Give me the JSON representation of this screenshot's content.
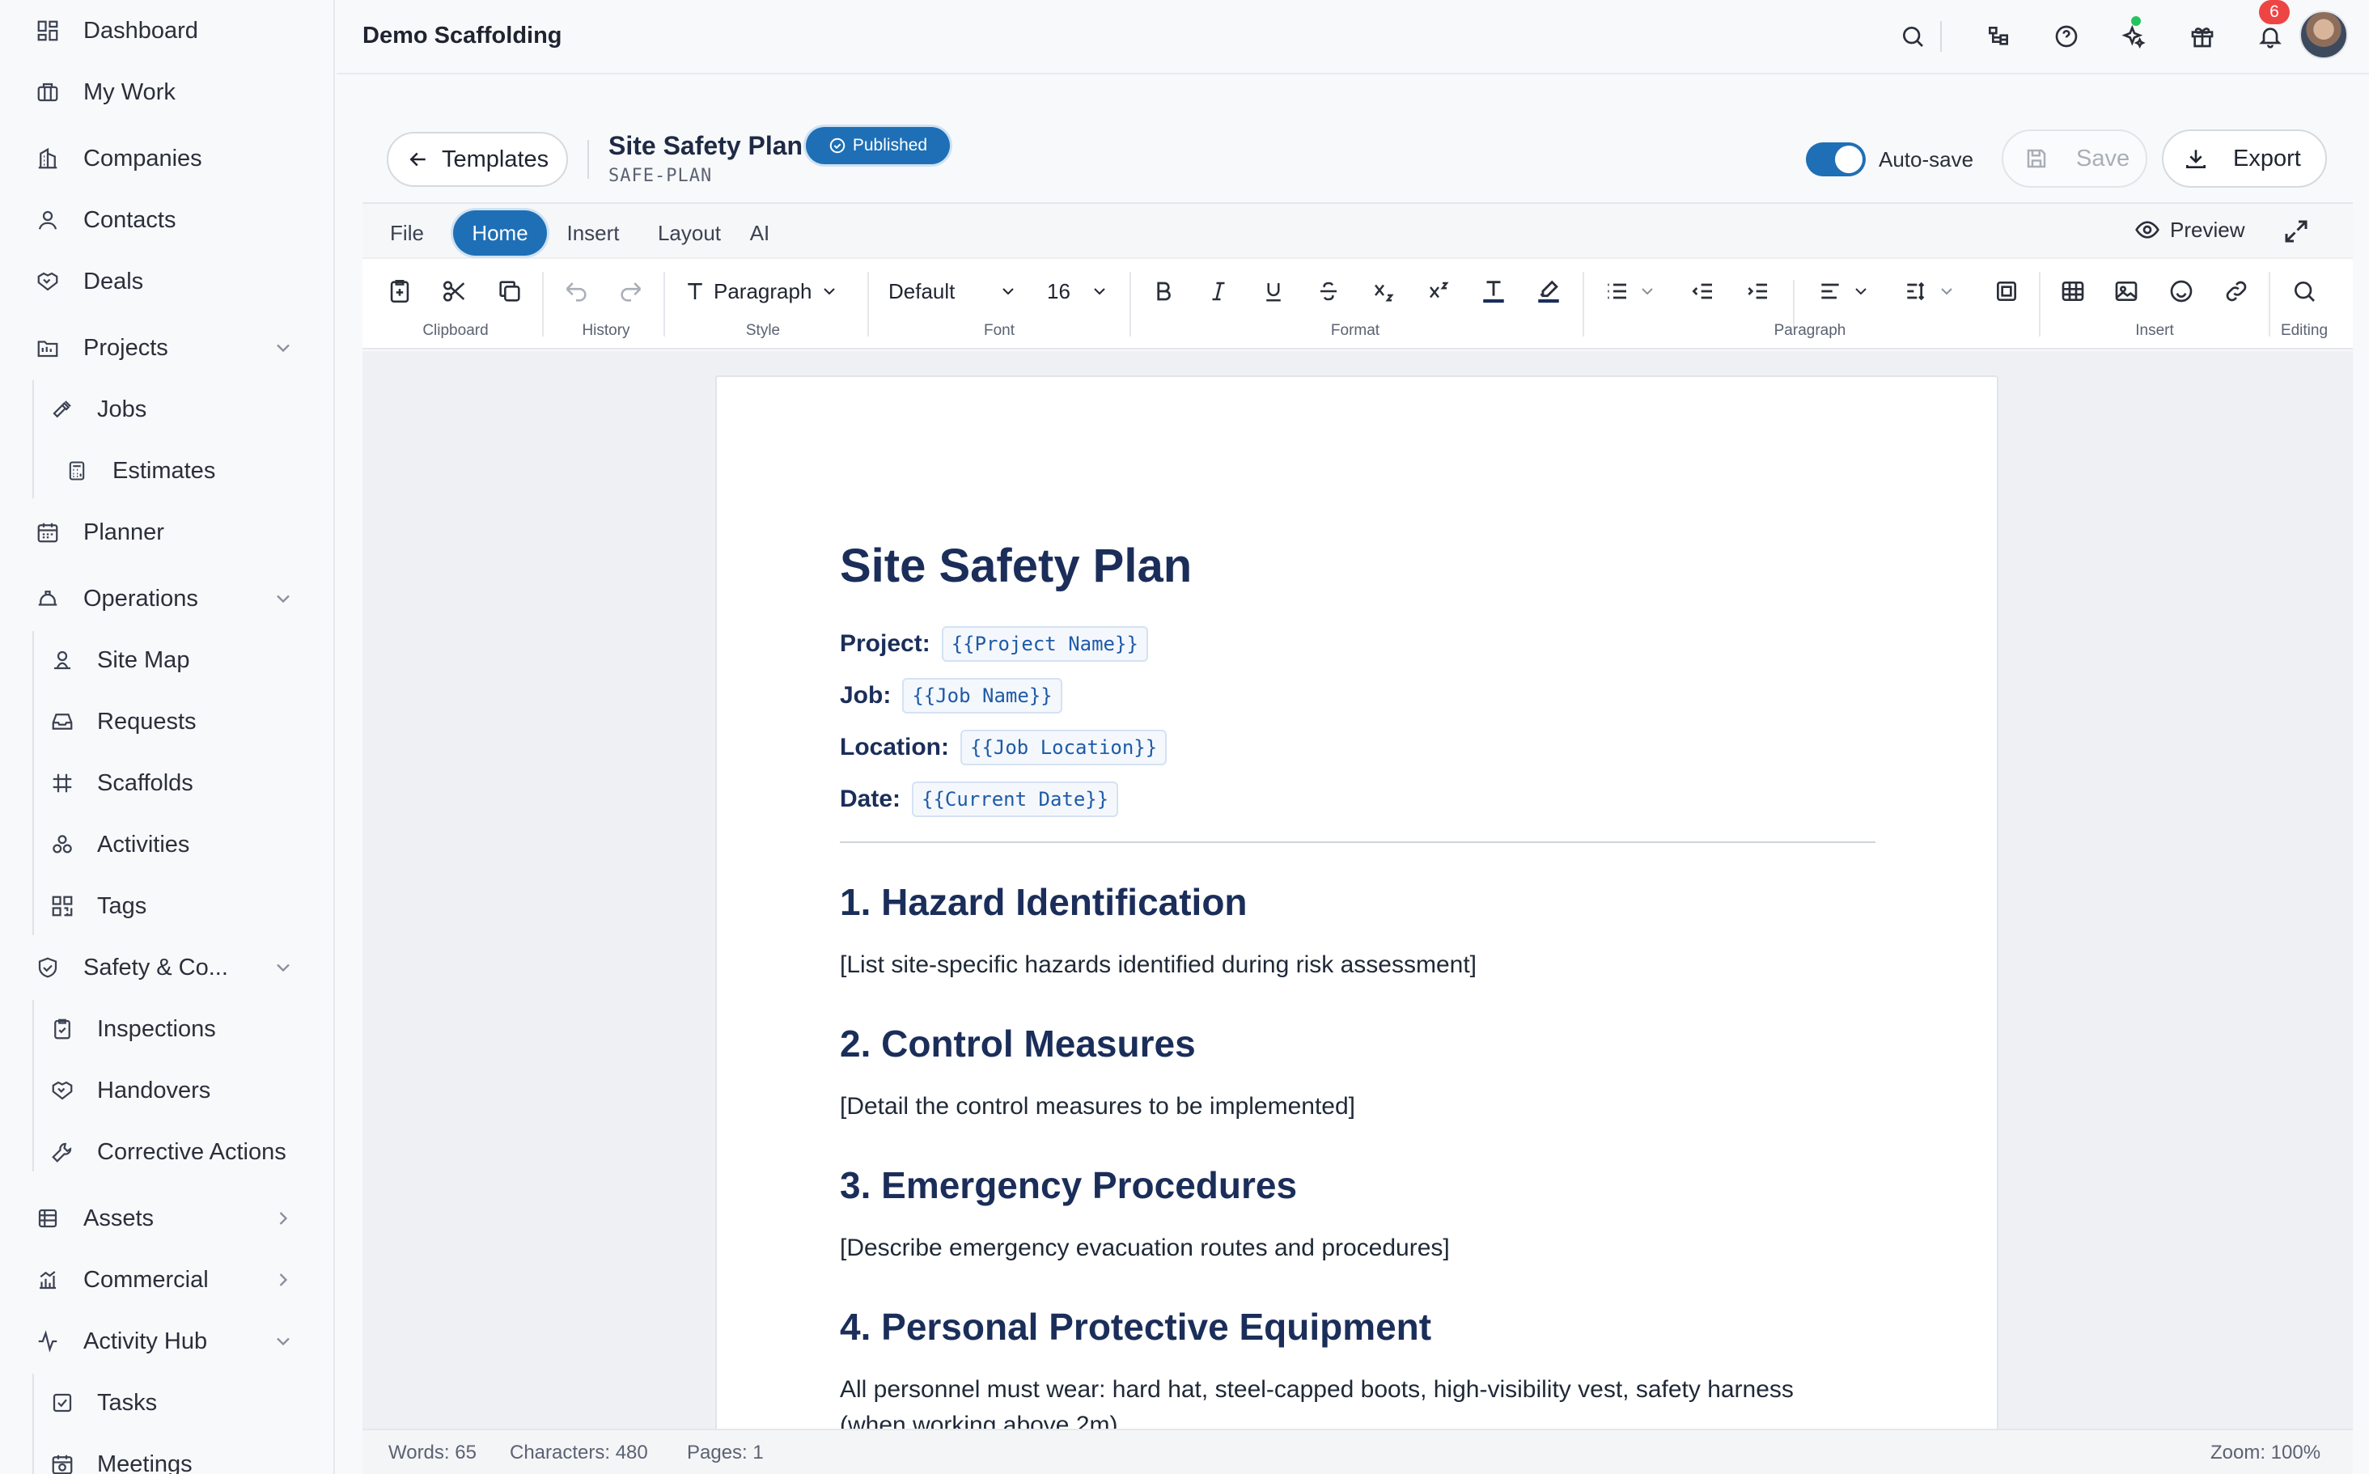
{
  "sidebar": {
    "items": [
      {
        "label": "Dashboard",
        "icon": "dashboard-icon"
      },
      {
        "label": "My Work",
        "icon": "briefcase-icon"
      },
      {
        "label": "Companies",
        "icon": "building-icon"
      },
      {
        "label": "Contacts",
        "icon": "user-icon"
      },
      {
        "label": "Deals",
        "icon": "handshake-icon"
      },
      {
        "label": "Projects",
        "icon": "folder-icon"
      },
      {
        "label": "Jobs",
        "icon": "hammer-icon"
      },
      {
        "label": "Estimates",
        "icon": "calculator-icon"
      },
      {
        "label": "Planner",
        "icon": "calendar-icon"
      },
      {
        "label": "Operations",
        "icon": "hardhat-icon"
      },
      {
        "label": "Site Map",
        "icon": "map-pin-icon"
      },
      {
        "label": "Requests",
        "icon": "inbox-icon"
      },
      {
        "label": "Scaffolds",
        "icon": "grid-hash-icon"
      },
      {
        "label": "Activities",
        "icon": "activities-icon"
      },
      {
        "label": "Tags",
        "icon": "qr-code-icon"
      },
      {
        "label": "Safety & Co...",
        "icon": "shield-check-icon"
      },
      {
        "label": "Inspections",
        "icon": "clipboard-check-icon"
      },
      {
        "label": "Handovers",
        "icon": "handover-icon"
      },
      {
        "label": "Corrective Actions",
        "icon": "wrench-icon"
      },
      {
        "label": "Assets",
        "icon": "assets-icon"
      },
      {
        "label": "Commercial",
        "icon": "chart-icon"
      },
      {
        "label": "Activity Hub",
        "icon": "pulse-icon"
      },
      {
        "label": "Tasks",
        "icon": "checkbox-icon"
      },
      {
        "label": "Meetings",
        "icon": "calendar-clock-icon"
      }
    ]
  },
  "topbar": {
    "title": "Demo Scaffolding",
    "notification_count": "6",
    "status_dot_color": "#22c55e"
  },
  "header": {
    "back_label": "Templates",
    "doc_title": "Site Safety Plan",
    "doc_code": "SAFE-PLAN",
    "status_badge": "Published",
    "autosave_label": "Auto-save",
    "autosave_on": true,
    "save_label": "Save",
    "export_label": "Export"
  },
  "ribbon": {
    "tabs": [
      "File",
      "Home",
      "Insert",
      "Layout",
      "AI"
    ],
    "active_tab": "Home",
    "preview_label": "Preview",
    "style_value": "Paragraph",
    "font_value": "Default",
    "size_value": "16",
    "groups": [
      "Clipboard",
      "History",
      "Style",
      "Font",
      "Format",
      "Paragraph",
      "Insert",
      "Editing"
    ]
  },
  "document": {
    "title": "Site Safety Plan",
    "meta": [
      {
        "key": "Project:",
        "token": "{{Project Name}}"
      },
      {
        "key": "Job:",
        "token": "{{Job Name}}"
      },
      {
        "key": "Location:",
        "token": "{{Job Location}}"
      },
      {
        "key": "Date:",
        "token": "{{Current Date}}"
      }
    ],
    "sections": [
      {
        "heading": "1. Hazard Identification",
        "body": "[List site-specific hazards identified during risk assessment]"
      },
      {
        "heading": "2. Control Measures",
        "body": "[Detail the control measures to be implemented]"
      },
      {
        "heading": "3. Emergency Procedures",
        "body": "[Describe emergency evacuation routes and procedures]"
      },
      {
        "heading": "4. Personal Protective Equipment",
        "body": "All personnel must wear: hard hat, steel-capped boots, high-visibility vest, safety harness",
        "body2": "(when working above 2m)"
      }
    ]
  },
  "statusbar": {
    "words": "Words: 65",
    "characters": "Characters: 480",
    "pages": "Pages: 1",
    "zoom": "Zoom: 100%"
  },
  "colors": {
    "accent": "#1e6fb6",
    "heading": "#1b2e5a",
    "badge_red": "#ef4444"
  }
}
